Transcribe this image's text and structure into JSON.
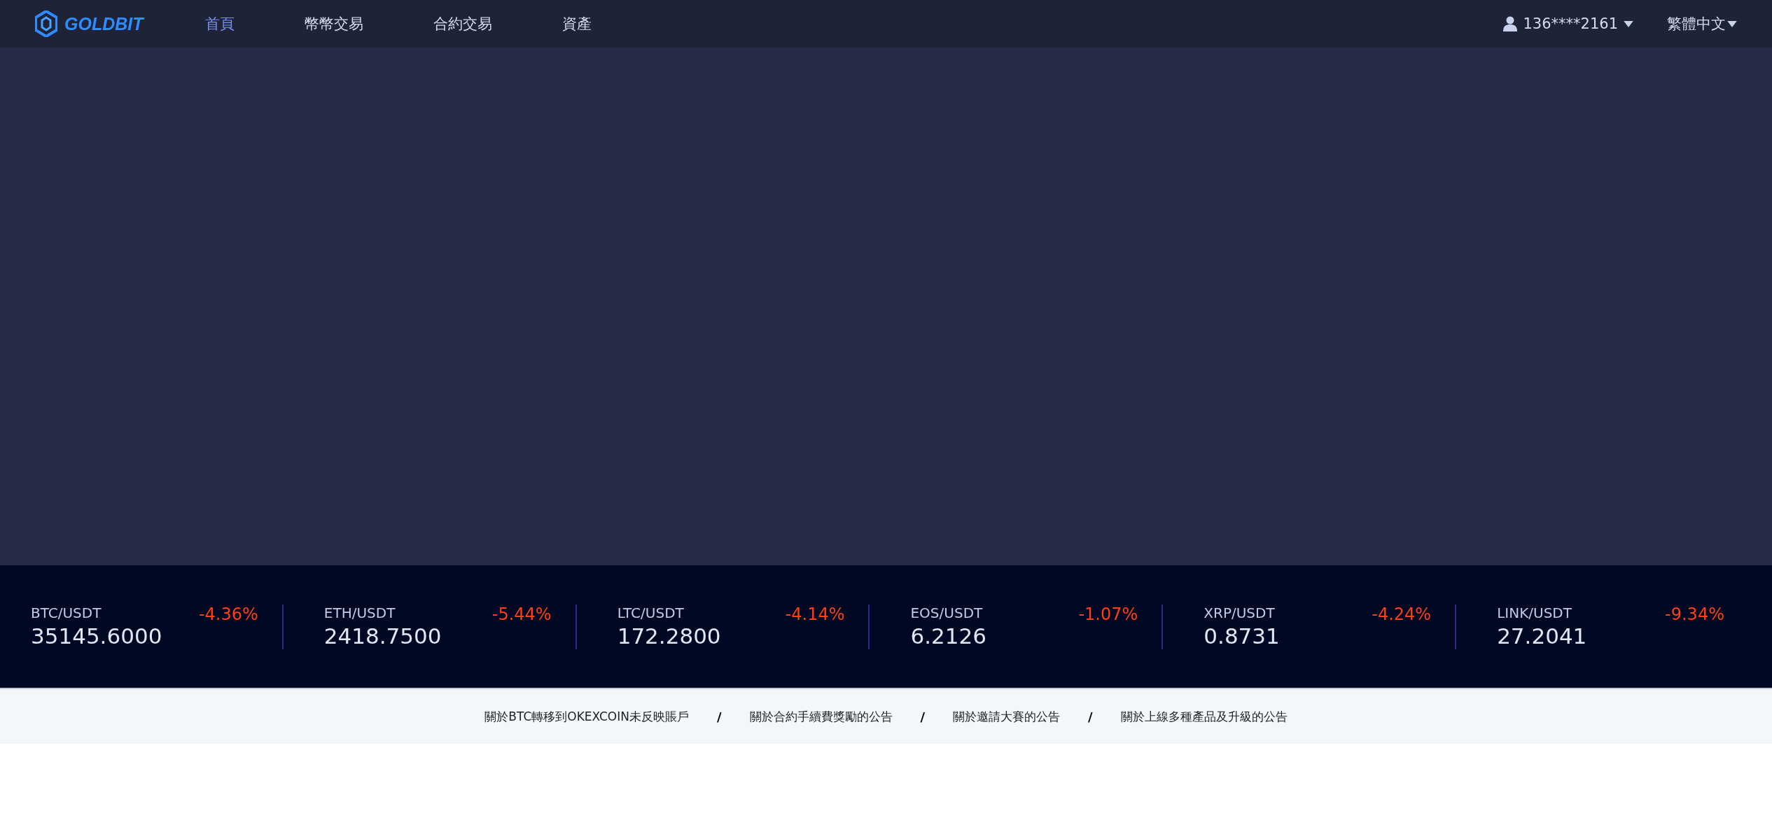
{
  "navbar": {
    "logo": "GOLDBIT",
    "items": [
      {
        "label": "首頁",
        "selected": true
      },
      {
        "label": "幣幣交易",
        "selected": false
      },
      {
        "label": "合約交易",
        "selected": false
      },
      {
        "label": "資產",
        "selected": false
      }
    ],
    "account": "136****2161",
    "language": "繁體中文"
  },
  "tickers": [
    {
      "pair": "BTC/USDT",
      "price": "35145.6000",
      "change": "-4.36%"
    },
    {
      "pair": "ETH/USDT",
      "price": "2418.7500",
      "change": "-5.44%"
    },
    {
      "pair": "LTC/USDT",
      "price": "172.2800",
      "change": "-4.14%"
    },
    {
      "pair": "EOS/USDT",
      "price": "6.2126",
      "change": "-1.07%"
    },
    {
      "pair": "XRP/USDT",
      "price": "0.8731",
      "change": "-4.24%"
    },
    {
      "pair": "LINK/USDT",
      "price": "27.2041",
      "change": "-9.34%"
    }
  ],
  "announcements": [
    {
      "kind": "link",
      "text": "關於BTC轉移到OKEXCOIN未反映賬戶"
    },
    {
      "kind": "separator",
      "text": "/"
    },
    {
      "kind": "link",
      "text": "關於合約手續費獎勵的公告"
    },
    {
      "kind": "separator",
      "text": "/"
    },
    {
      "kind": "link",
      "text": "關於邀請大賽的公告"
    },
    {
      "kind": "separator",
      "text": "/"
    },
    {
      "kind": "link",
      "text": "關於上線多種產品及升級的公告"
    }
  ]
}
